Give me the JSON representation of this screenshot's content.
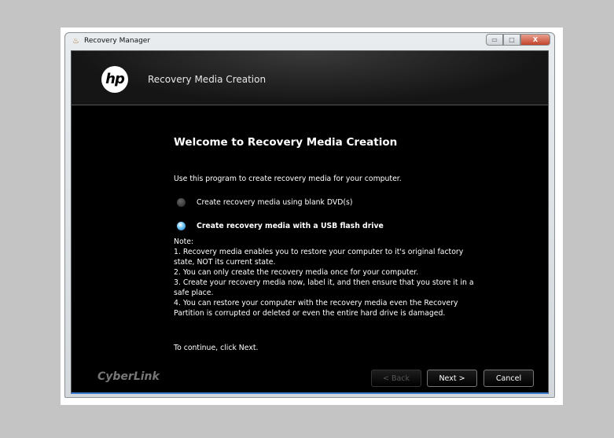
{
  "window": {
    "title": "Recovery Manager",
    "controls": {
      "minimize": "▭",
      "maximize": "□",
      "close": "X"
    }
  },
  "header": {
    "logo": "hp",
    "title": "Recovery Media Creation"
  },
  "main": {
    "heading": "Welcome to Recovery Media Creation",
    "intro": "Use this program to create recovery media for your computer.",
    "options": [
      {
        "label": "Create recovery media using blank DVD(s)",
        "selected": false
      },
      {
        "label": "Create recovery media with a USB flash drive",
        "selected": true
      }
    ],
    "notes": [
      "Note:",
      "1. Recovery media enables you to restore your computer to it's original factory state, NOT its current state.",
      "2. You can only create the recovery media once for your computer.",
      "3. Create your recovery media now, label it, and then ensure that you store it in a safe place.",
      "4. You can restore your computer with the recovery media even the Recovery Partition is corrupted or deleted or even the entire hard drive is damaged."
    ],
    "continue": "To continue, click Next."
  },
  "footer": {
    "brand": "CyberLink",
    "back": "< Back",
    "next": "Next >",
    "cancel": "Cancel"
  }
}
